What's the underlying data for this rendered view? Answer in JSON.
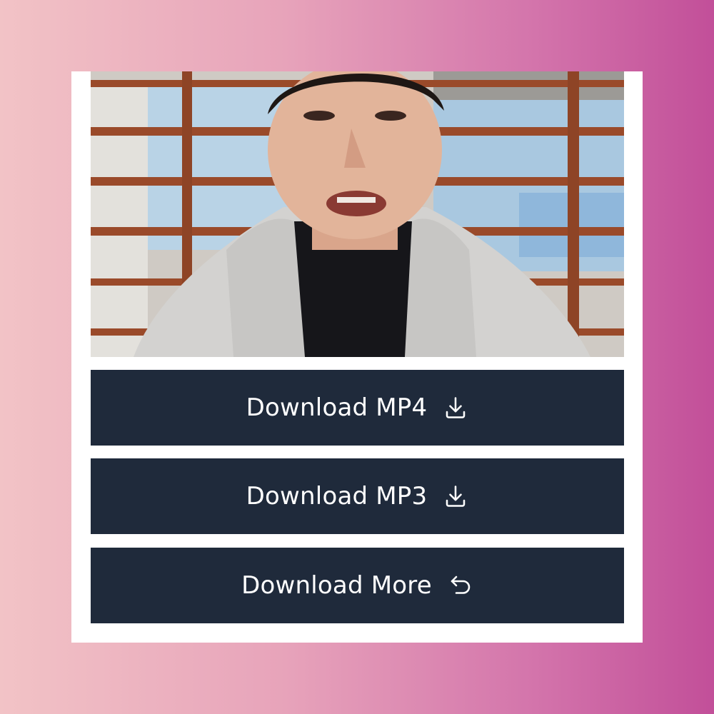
{
  "buttons": {
    "mp4": {
      "label": "Download MP4",
      "icon": "download-icon"
    },
    "mp3": {
      "label": "Download MP3",
      "icon": "download-icon"
    },
    "more": {
      "label": "Download More",
      "icon": "undo-arrow-icon"
    }
  },
  "colors": {
    "background_gradient": [
      "#f2c3c6",
      "#e7a3ba",
      "#d374ab",
      "#c24f99"
    ],
    "card": "#ffffff",
    "button": "#1f2a3b",
    "button_text": "#ffffff"
  }
}
